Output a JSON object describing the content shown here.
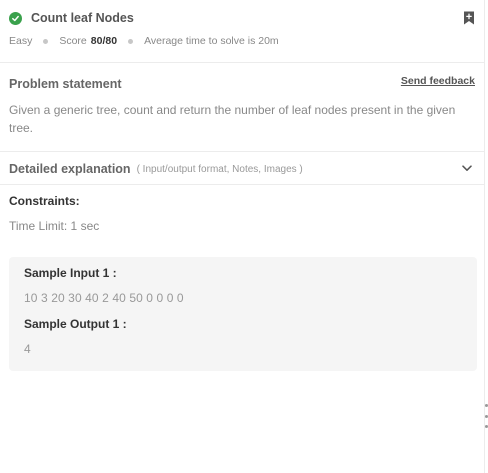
{
  "problem": {
    "title": "Count leaf Nodes",
    "difficulty": "Easy",
    "score_label": "Score",
    "score_value": "80/80",
    "avg_time": "Average time to solve is 20m"
  },
  "statement": {
    "heading": "Problem statement",
    "feedback_link": "Send feedback",
    "text": "Given a generic tree, count and return the number of leaf nodes present in the given tree."
  },
  "explanation": {
    "heading": "Detailed explanation",
    "subtext": "( Input/output format, Notes, Images )"
  },
  "constraints": {
    "heading": "Constraints:",
    "time_limit": "Time Limit: 1 sec"
  },
  "sample": {
    "input_label": "Sample Input 1 :",
    "input_value": "10 3 20 30 40 2 40 50 0 0 0 0",
    "output_label": "Sample Output 1 :",
    "output_value": "4"
  },
  "icons": {
    "solved": "check-circle-icon",
    "bookmark": "bookmark-plus-icon",
    "expand": "chevron-down-icon"
  },
  "colors": {
    "solved_green": "#3aa14c",
    "sample_bg": "#f5f5f5"
  }
}
